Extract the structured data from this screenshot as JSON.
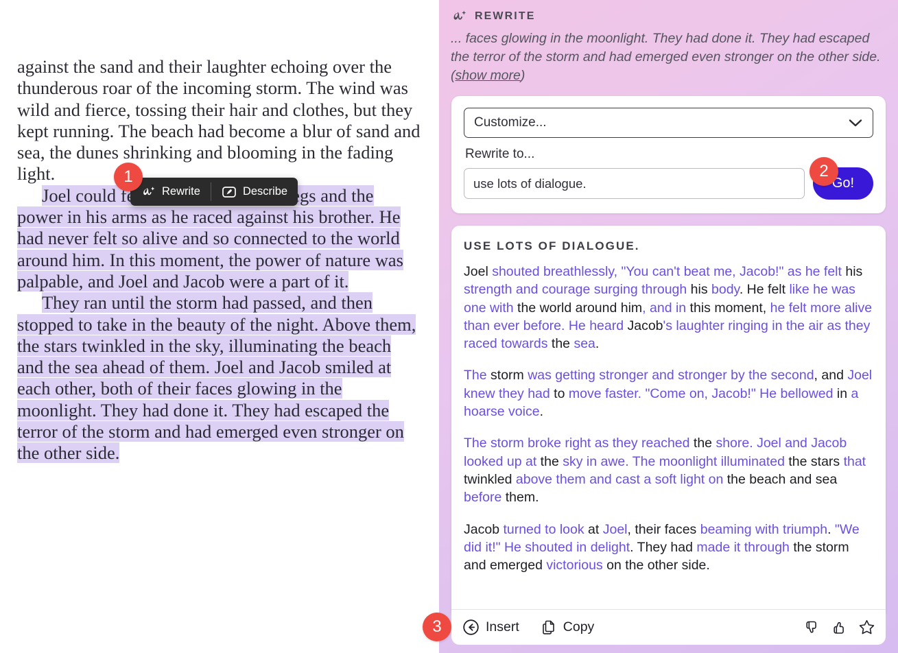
{
  "document": {
    "paragraphs": [
      {
        "indent": false,
        "selected": false,
        "text": "against the sand and their laughter echoing over the thunderous roar of the incoming storm. The wind was wild and fierce, tossing their hair and clothes, but they kept running. The beach had become a blur of sand and sea, the dunes shrinking and blooming in the fading light."
      },
      {
        "indent": true,
        "selected": true,
        "text": "Joel could feel the strength in his legs and the power in his arms as he raced against his brother. He had never felt so alive and so connected to the world around him. In this moment, the power of nature was palpable, and Joel and Jacob were a part of it."
      },
      {
        "indent": true,
        "selected": true,
        "text": "They ran until the storm had passed, and then stopped to take in the beauty of the night. Above them, the stars twinkled in the sky, illuminating the beach and the sea ahead of them. Joel and Jacob smiled at each other, both of their faces glowing in the moonlight. They had done it. They had escaped the terror of the storm and had emerged even stronger on the other side."
      }
    ]
  },
  "selection_toolbar": {
    "rewrite_label": "Rewrite",
    "rewrite_icon": "ai-star-icon",
    "describe_label": "Describe",
    "describe_icon": "describe-frame-icon"
  },
  "badges": {
    "one": "1",
    "two": "2",
    "three": "3",
    "color": "#ef4a42"
  },
  "ai_panel": {
    "header": {
      "icon": "ai-star-icon",
      "title": "REWRITE",
      "source_excerpt": "... faces glowing in the moonlight. They had done it. They had escaped the terror of the storm and had emerged even stronger on the other side. (",
      "show_more_label": "show more",
      "source_excerpt_tail": ")"
    },
    "prompt": {
      "customize_value": "Customize...",
      "customize_icon": "chevron-down-icon",
      "rewrite_to_label": "Rewrite to...",
      "rewrite_input_value": "use lots of dialogue.",
      "rewrite_input_placeholder": "Rewrite to...",
      "go_label": "Go!",
      "go_color": "#3a18d8"
    },
    "result": {
      "title": "USE LOTS OF DIALOGUE.",
      "added_color": "#6b4fe0",
      "paragraphs": [
        [
          {
            "t": "Joel ",
            "a": false
          },
          {
            "t": "shouted breathlessly,",
            "a": true
          },
          {
            "t": " ",
            "a": false
          },
          {
            "t": "\"You can't beat me, Jacob!\" as he felt",
            "a": true
          },
          {
            "t": " his ",
            "a": false
          },
          {
            "t": "strength and courage surging through",
            "a": true
          },
          {
            "t": " his ",
            "a": false
          },
          {
            "t": "body",
            "a": true
          },
          {
            "t": ". He felt ",
            "a": false
          },
          {
            "t": "like he was one with",
            "a": true
          },
          {
            "t": " the world around him",
            "a": false
          },
          {
            "t": ", and in",
            "a": true
          },
          {
            "t": " this moment, ",
            "a": false
          },
          {
            "t": "he felt more alive than ever before. He heard",
            "a": true
          },
          {
            "t": " Jacob",
            "a": false
          },
          {
            "t": "'s laughter ringing in the air as they raced towards",
            "a": true
          },
          {
            "t": " the ",
            "a": false
          },
          {
            "t": "sea",
            "a": true
          },
          {
            "t": ".",
            "a": false
          }
        ],
        [
          {
            "t": "The",
            "a": true
          },
          {
            "t": " storm ",
            "a": false
          },
          {
            "t": "was getting stronger and stronger by the second",
            "a": true
          },
          {
            "t": ", and ",
            "a": false
          },
          {
            "t": "Joel knew they had",
            "a": true
          },
          {
            "t": " to ",
            "a": false
          },
          {
            "t": "move faster. \"Come on, Jacob!\" He bellowed",
            "a": true
          },
          {
            "t": " in ",
            "a": false
          },
          {
            "t": "a hoarse voice",
            "a": true
          },
          {
            "t": ".",
            "a": false
          }
        ],
        [
          {
            "t": "The storm broke right as they reached",
            "a": true
          },
          {
            "t": " the ",
            "a": false
          },
          {
            "t": "shore. Joel and Jacob looked up at",
            "a": true
          },
          {
            "t": " the ",
            "a": false
          },
          {
            "t": "sky in awe. The moonlight illuminated",
            "a": true
          },
          {
            "t": " the stars ",
            "a": false
          },
          {
            "t": "that",
            "a": true
          },
          {
            "t": " twinkled ",
            "a": false
          },
          {
            "t": "above them and cast a soft light on",
            "a": true
          },
          {
            "t": " the beach and sea ",
            "a": false
          },
          {
            "t": "before",
            "a": true
          },
          {
            "t": " them.",
            "a": false
          }
        ],
        [
          {
            "t": "Jacob ",
            "a": false
          },
          {
            "t": "turned to look",
            "a": true
          },
          {
            "t": " at ",
            "a": false
          },
          {
            "t": "Joel",
            "a": true
          },
          {
            "t": ", their faces ",
            "a": false
          },
          {
            "t": "beaming with triumph",
            "a": true
          },
          {
            "t": ". ",
            "a": false
          },
          {
            "t": "\"We did it!\" He shouted in delight",
            "a": true
          },
          {
            "t": ". They had ",
            "a": false
          },
          {
            "t": "made it through",
            "a": true
          },
          {
            "t": " the storm and emerged ",
            "a": false
          },
          {
            "t": "victorious",
            "a": true
          },
          {
            "t": " on the other side.",
            "a": false
          }
        ]
      ]
    },
    "footer": {
      "insert_label": "Insert",
      "insert_icon": "arrow-left-circle-icon",
      "copy_label": "Copy",
      "copy_icon": "copy-documents-icon",
      "thumbs_down_icon": "thumbs-down-icon",
      "thumbs_up_icon": "thumbs-up-icon",
      "star_icon": "star-icon"
    }
  }
}
